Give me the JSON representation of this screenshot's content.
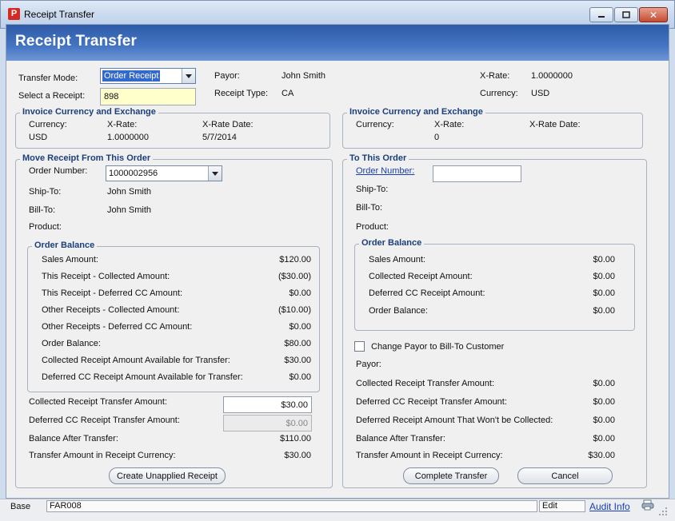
{
  "window": {
    "title": "Receipt Transfer",
    "icon": "app-logo-icon"
  },
  "banner": {
    "title": "Receipt Transfer"
  },
  "header": {
    "transfer_mode_label": "Transfer Mode:",
    "transfer_mode_value": "Order Receipt",
    "select_receipt_label": "Select a Receipt:",
    "select_receipt_value": "898",
    "payor_label": "Payor:",
    "payor_value": "John Smith",
    "receipt_type_label": "Receipt Type:",
    "receipt_type_value": "CA",
    "xrate_label": "X-Rate:",
    "xrate_value": "1.0000000",
    "currency_label": "Currency:",
    "currency_value": "USD"
  },
  "invoice_left": {
    "title": "Invoice Currency and Exchange",
    "currency_label": "Currency:",
    "currency_value": "USD",
    "xrate_label": "X-Rate:",
    "xrate_value": "1.0000000",
    "xrate_date_label": "X-Rate Date:",
    "xrate_date_value": "5/7/2014"
  },
  "invoice_right": {
    "title": "Invoice Currency and Exchange",
    "currency_label": "Currency:",
    "currency_value": "",
    "xrate_label": "X-Rate:",
    "xrate_value": "0",
    "xrate_date_label": "X-Rate Date:",
    "xrate_date_value": ""
  },
  "from_order": {
    "title": "Move Receipt From This Order",
    "order_number_label": "Order Number:",
    "order_number_value": "1000002956",
    "ship_to_label": "Ship-To:",
    "ship_to_value": "John Smith",
    "bill_to_label": "Bill-To:",
    "bill_to_value": "John Smith",
    "product_label": "Product:",
    "balance_title": "Order Balance",
    "balance_rows": [
      {
        "label": "Sales Amount:",
        "value": "$120.00"
      },
      {
        "label": "This Receipt - Collected Amount:",
        "value": "($30.00)"
      },
      {
        "label": "This Receipt - Deferred CC Amount:",
        "value": "$0.00"
      },
      {
        "label": "Other Receipts - Collected Amount:",
        "value": "($10.00)"
      },
      {
        "label": "Other Receipts - Deferred CC Amount:",
        "value": "$0.00"
      },
      {
        "label": "Order Balance:",
        "value": "$80.00"
      },
      {
        "label": "Collected Receipt Amount Available for Transfer:",
        "value": "$30.00"
      },
      {
        "label": "Deferred CC Receipt Amount Available for  Transfer:",
        "value": "$0.00"
      }
    ],
    "collected_transfer_label": "Collected Receipt Transfer Amount:",
    "collected_transfer_value": "$30.00",
    "deferred_transfer_label": "Deferred CC Receipt Transfer Amount:",
    "deferred_transfer_value": "$0.00",
    "balance_after_label": "Balance After Transfer:",
    "balance_after_value": "$110.00",
    "transfer_receipt_currency_label": "Transfer Amount in Receipt Currency:",
    "transfer_receipt_currency_value": "$30.00",
    "create_unapplied_button": "Create Unapplied Receipt"
  },
  "to_order": {
    "title": "To This Order",
    "order_number_label": "Order Number:",
    "order_number_value": "",
    "ship_to_label": "Ship-To:",
    "bill_to_label": "Bill-To:",
    "product_label": "Product:",
    "balance_title": "Order Balance",
    "balance_rows": [
      {
        "label": "Sales Amount:",
        "value": "$0.00"
      },
      {
        "label": "Collected Receipt Amount:",
        "value": "$0.00"
      },
      {
        "label": "Deferred CC Receipt Amount:",
        "value": "$0.00"
      },
      {
        "label": "Order Balance:",
        "value": "$0.00"
      }
    ],
    "change_payor_label": "Change Payor to Bill-To Customer",
    "change_payor_checked": false,
    "payor_label": "Payor:",
    "transfer_rows": [
      {
        "label": "Collected Receipt Transfer Amount:",
        "value": "$0.00"
      },
      {
        "label": "Deferred CC Receipt Transfer Amount:",
        "value": "$0.00"
      },
      {
        "label": "Deferred Receipt Amount That Won't be Collected:",
        "value": "$0.00"
      },
      {
        "label": "Balance After Transfer:",
        "value": "$0.00"
      },
      {
        "label": "Transfer Amount in Receipt Currency:",
        "value": "$30.00"
      }
    ],
    "complete_button": "Complete Transfer",
    "cancel_button": "Cancel"
  },
  "status": {
    "mode": "Base",
    "form_id": "FAR008",
    "state": "Edit",
    "audit_info": "Audit Info"
  },
  "colors": {
    "banner": "#2d5aa8",
    "group_title": "#1b3f7c",
    "receipt_input": "#ffffcc"
  }
}
